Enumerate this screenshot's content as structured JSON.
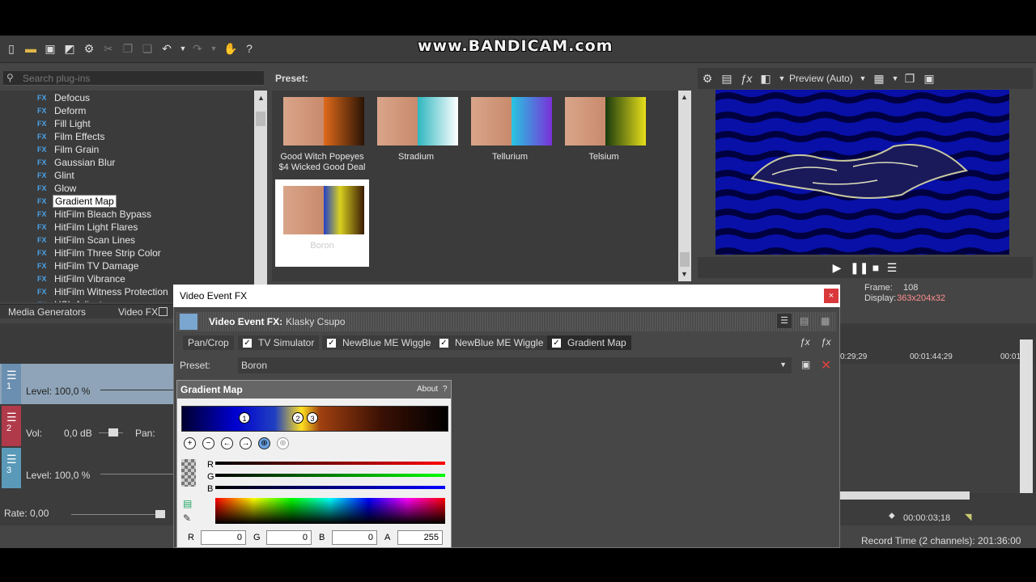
{
  "watermark": "www.BANDICAM.com",
  "search": {
    "placeholder": "Search plug-ins"
  },
  "plugins": [
    "Defocus",
    "Deform",
    "Fill Light",
    "Film Effects",
    "Film Grain",
    "Gaussian Blur",
    "Glint",
    "Glow",
    "Gradient Map",
    "HitFilm Bleach Bypass",
    "HitFilm Light Flares",
    "HitFilm Scan Lines",
    "HitFilm Three Strip Color",
    "HitFilm TV Damage",
    "HitFilm Vibrance",
    "HitFilm Witness Protection",
    "HSL Adjust"
  ],
  "selected_plugin": "Gradient Map",
  "tabs": {
    "media_generators": "Media Generators",
    "video_fx": "Video FX"
  },
  "preset_header": "Preset:",
  "presets": [
    {
      "line1": "Good Witch Popeyes",
      "line2": "$4 Wicked Good Deal"
    },
    {
      "line1": "Stradium",
      "line2": ""
    },
    {
      "line1": "Tellurium",
      "line2": ""
    },
    {
      "line1": "Telsium",
      "line2": ""
    },
    {
      "line1": "Boron",
      "line2": ""
    }
  ],
  "preview": {
    "mode": "Preview (Auto)",
    "frame_label": "Frame:",
    "frame_value": "108",
    "display_label": "Display:",
    "display_value": "363x204x32"
  },
  "tracks": {
    "t1": {
      "num": "1",
      "level": "Level: 100,0 %"
    },
    "t2": {
      "num": "2",
      "vol_label": "Vol:",
      "vol_value": "0,0 dB",
      "pan_label": "Pan:"
    },
    "t3": {
      "num": "3",
      "level": "Level: 100,0 %"
    },
    "rate": "Rate: 0,00"
  },
  "timeline": {
    "tc1": "0:29;29",
    "tc2": "00:01:44;29",
    "tc3": "00:01",
    "cursor_time": "00:00:03;18",
    "record_time": "Record Time (2 channels): 201:36:00"
  },
  "dialog": {
    "title": "Video Event FX",
    "close": "×",
    "header_label": "Video Event FX:",
    "header_value": "Klasky Csupo",
    "chain": [
      "Pan/Crop",
      "TV Simulator",
      "NewBlue ME Wiggle",
      "NewBlue ME Wiggle",
      "Gradient Map"
    ],
    "preset_label": "Preset:",
    "preset_value": "Boron",
    "gm_title": "Gradient Map",
    "about": "About",
    "help": "?",
    "stops": [
      "1",
      "2",
      "3"
    ],
    "r_label": "R",
    "g_label": "G",
    "b_label": "B",
    "a_label": "A",
    "r_value": "0",
    "g_value": "0",
    "b_value": "0",
    "a_value": "255"
  }
}
